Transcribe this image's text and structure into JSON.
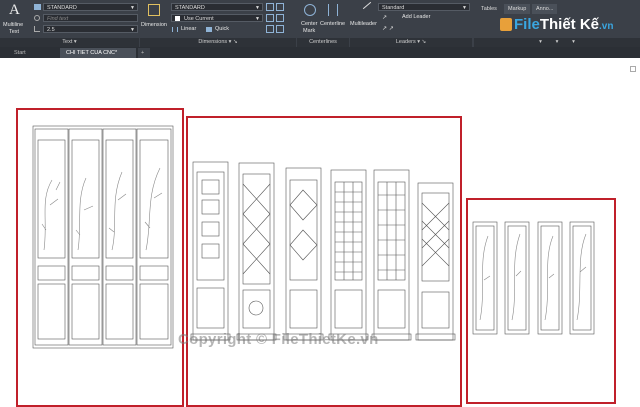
{
  "ribbon": {
    "text_panel": {
      "multiline_label": "Multiline",
      "text_label": "Text",
      "style_value": "STANDARD",
      "find_placeholder": "Find text",
      "height_value": "2.5",
      "panel_title": "Text"
    },
    "dimensions_panel": {
      "dimension_label": "Dimension",
      "style_value": "STANDARD",
      "layer_value": "Use Current",
      "linear_label": "Linear",
      "quick_label": "Quick",
      "panel_title": "Dimensions"
    },
    "centerlines_panel": {
      "center_mark_label1": "Center",
      "center_mark_label2": "Mark",
      "centerline_label": "Centerline",
      "panel_title": "Centerlines"
    },
    "leaders_panel": {
      "multileader_label": "Multileader",
      "style_value": "Standard",
      "add_leader_label": "Add Leader",
      "panel_title": "Leaders"
    },
    "right_tabs": [
      "Tables",
      "Markup",
      "Anno..."
    ]
  },
  "doc_tabs": {
    "start": "Start",
    "active": "CHI TIET CUA CNC*",
    "add": "+"
  },
  "watermark": "Copyright © FileThietKe.vn",
  "logo": {
    "part1": "File",
    "part2": "Thiết Kế",
    "part3": ".vn"
  },
  "colors": {
    "ribbon_bg": "#3b4048",
    "accent_red": "#c0202a",
    "drawing_line": "#555555"
  }
}
